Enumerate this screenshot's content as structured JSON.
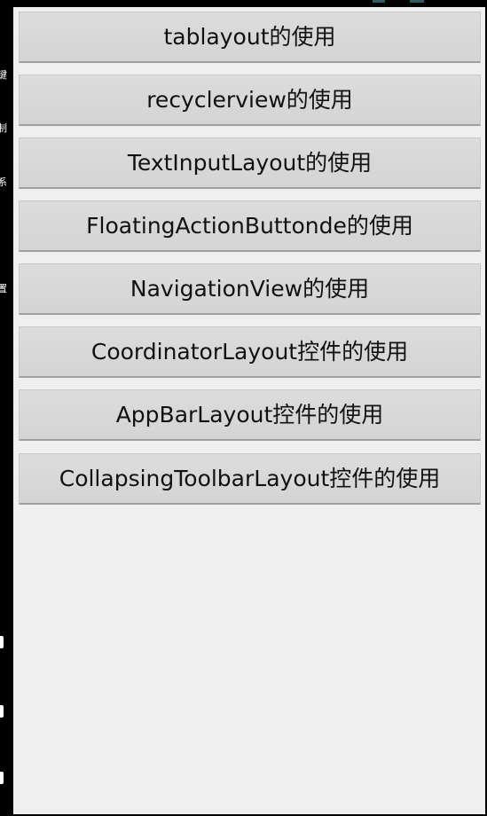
{
  "left_strip": {
    "chars": [
      "键",
      "制",
      "系",
      "置"
    ]
  },
  "buttons": [
    {
      "label": "tablayout的使用"
    },
    {
      "label": "recyclerview的使用"
    },
    {
      "label": "TextInputLayout的使用"
    },
    {
      "label": "FloatingActionButtonde的使用"
    },
    {
      "label": "NavigationView的使用"
    },
    {
      "label": "CoordinatorLayout控件的使用"
    },
    {
      "label": "AppBarLayout控件的使用"
    },
    {
      "label": "CollapsingToolbarLayout控件的使用"
    }
  ],
  "colors": {
    "background": "#efefef",
    "button": "#d8d8d8",
    "text": "#111111"
  }
}
